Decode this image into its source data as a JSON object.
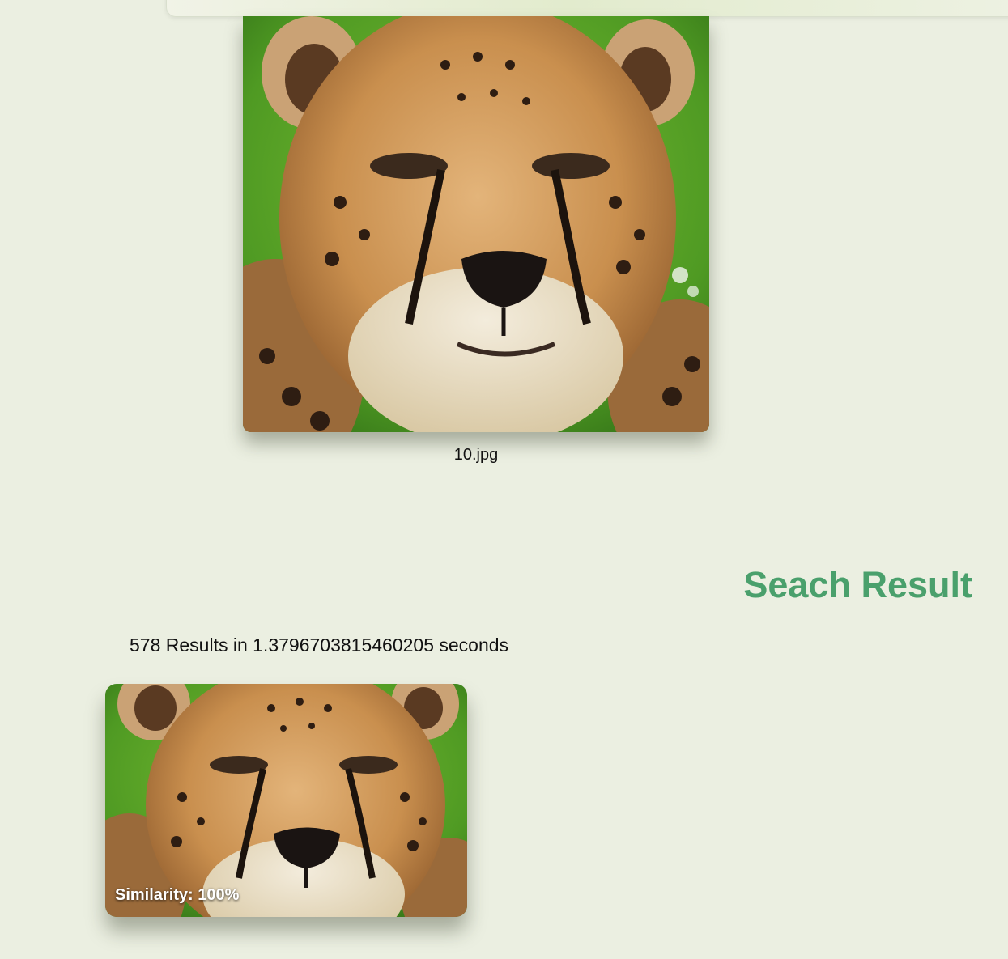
{
  "colors": {
    "accent": "#4aa06c",
    "background": "#ebefe1"
  },
  "query": {
    "filename": "10.jpg",
    "image_icon": "cheetah-photo"
  },
  "results": {
    "title": "Seach Result",
    "stats": "578 Results in 1.3796703815460205 seconds",
    "items": [
      {
        "similarity_label": "Similarity: 100%",
        "image_icon": "cheetah-photo"
      }
    ]
  }
}
